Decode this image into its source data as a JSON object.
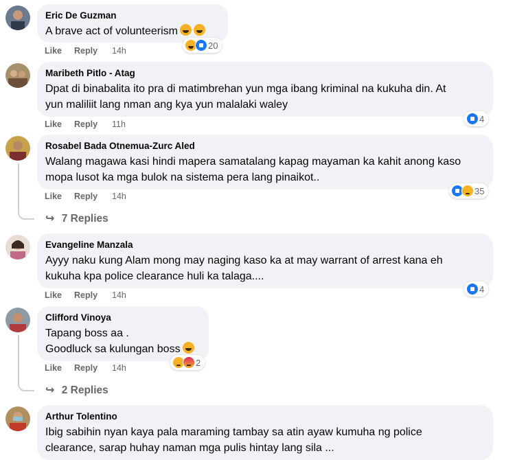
{
  "colors": {
    "bubble": "#f0f2f5",
    "meta": "#65676b",
    "like": "#1877f2",
    "reaction_yellow": "#f7b125"
  },
  "comments": [
    {
      "name": "Eric De Guzman",
      "lines": [
        "A brave act of volunteerism"
      ],
      "actions": {
        "like": "Like",
        "reply": "Reply",
        "time": "14h"
      },
      "reactions": {
        "icons": [
          "haha-icon",
          "like-icon"
        ],
        "count": "20"
      }
    },
    {
      "name": "Maribeth Pitlo - Atag",
      "lines": [
        "Dpat di binabalita ito pra di matimbrehan yun mga ibang kriminal na kukuha din. At",
        "yun maliliit lang nman ang kya yun malalaki waley"
      ],
      "actions": {
        "like": "Like",
        "reply": "Reply",
        "time": "11h"
      },
      "reactions": {
        "icons": [
          "like-icon"
        ],
        "count": "4"
      }
    },
    {
      "name": "Rosabel Bada Otnemua-Zurc Aled",
      "lines": [
        "Walang magawa kasi hindi mapera samatalang kapag mayaman ka kahit anong kaso",
        "mopa lusot ka mga bulok na sistema pera lang pinaikot.."
      ],
      "actions": {
        "like": "Like",
        "reply": "Reply",
        "time": "14h"
      },
      "reactions": {
        "icons": [
          "like-icon",
          "sad-icon"
        ],
        "count": "35"
      },
      "replies": "7 Replies"
    },
    {
      "name": "Evangeline Manzala",
      "lines": [
        "Ayyy naku kung Alam mong may naging kaso ka at may warrant of arrest kana eh",
        "kukuha kpa police clearance huli ka talaga...."
      ],
      "actions": {
        "like": "Like",
        "reply": "Reply",
        "time": "14h"
      },
      "reactions": {
        "icons": [
          "like-icon"
        ],
        "count": "4"
      }
    },
    {
      "name": "Clifford Vinoya",
      "lines": [
        "Tapang boss aa .",
        "Goodluck sa kulungan boss"
      ],
      "actions": {
        "like": "Like",
        "reply": "Reply",
        "time": "14h"
      },
      "reactions": {
        "icons": [
          "sad-icon",
          "angry-icon"
        ],
        "count": "2"
      },
      "replies": "2 Replies"
    },
    {
      "name": "Arthur Tolentino",
      "lines": [
        "Ibig sabihin nyan kaya pala maraming tambay sa atin ayaw kumuha ng police",
        "clearance, sarap huhay naman mga pulis hintay lang sila ..."
      ]
    }
  ]
}
